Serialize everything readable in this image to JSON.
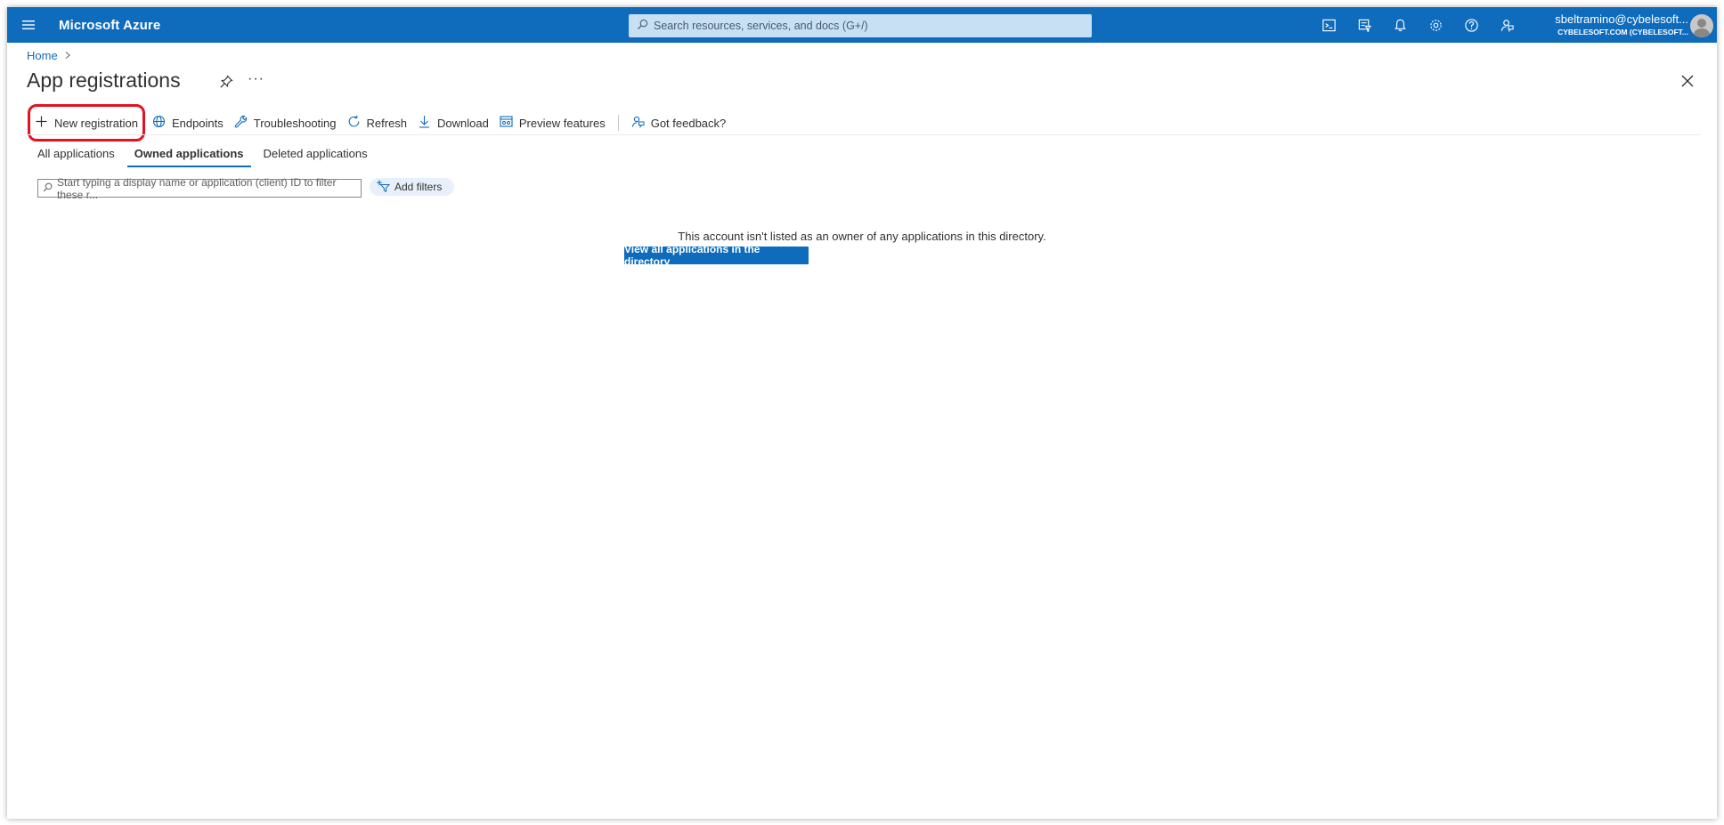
{
  "header": {
    "brand": "Microsoft Azure",
    "search_placeholder": "Search resources, services, and docs (G+/)",
    "account_email": "sbeltramino@cybelesoft...",
    "account_tenant": "CYBELESOFT.COM (CYBELESOFT...",
    "icons": [
      "cloud-shell-icon",
      "directory-filter-icon",
      "notifications-icon",
      "settings-icon",
      "help-icon",
      "feedback-icon"
    ]
  },
  "breadcrumb": {
    "home": "Home"
  },
  "page": {
    "title": "App registrations"
  },
  "commands": {
    "new_registration": "New registration",
    "endpoints": "Endpoints",
    "troubleshooting": "Troubleshooting",
    "refresh": "Refresh",
    "download": "Download",
    "preview_features": "Preview features",
    "feedback": "Got feedback?"
  },
  "tabs": {
    "all": "All applications",
    "owned": "Owned applications",
    "deleted": "Deleted applications",
    "active": "owned"
  },
  "filter": {
    "placeholder": "Start typing a display name or application (client) ID to filter these r...",
    "add_filters": "Add filters"
  },
  "empty_state": {
    "message": "This account isn't listed as an owner of any applications in this directory.",
    "button": "View all applications in the directory"
  },
  "colors": {
    "accent": "#0f6cbd",
    "highlight": "#e3121f"
  }
}
